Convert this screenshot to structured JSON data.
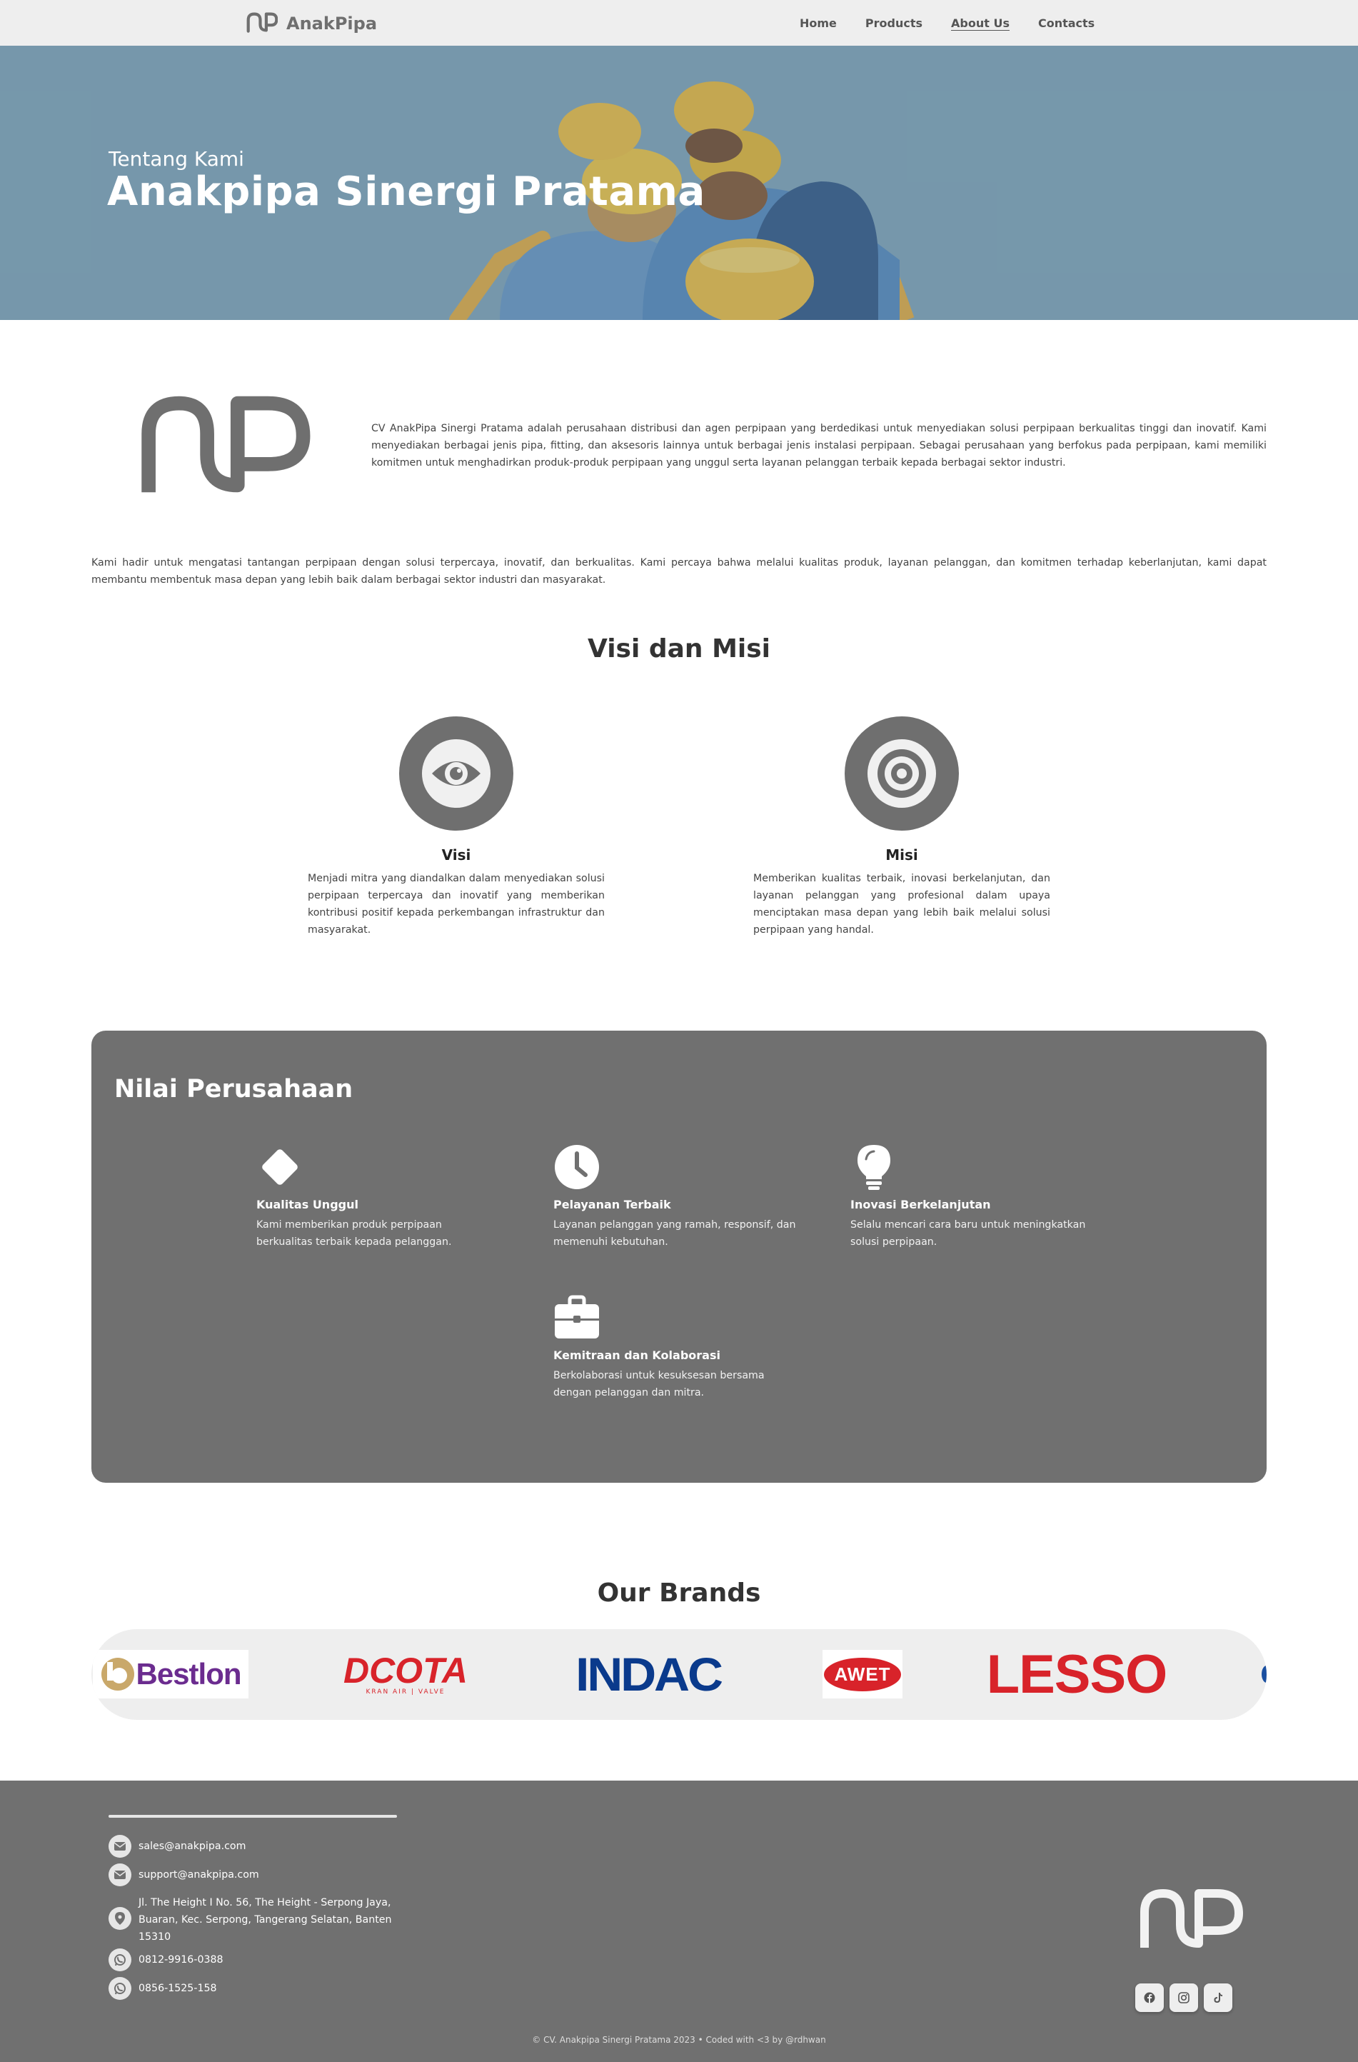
{
  "colors": {
    "nav_bg": "#eeeeee",
    "accent_gray": "#6f6f6f",
    "values_bg": "#707070",
    "footer_bg": "#707070",
    "text": "#333333",
    "white": "#ffffff"
  },
  "navbar": {
    "brand_name": "AnakPipa",
    "logo_icon": "np-logo-icon",
    "links": [
      {
        "label": "Home",
        "active": false
      },
      {
        "label": "Products",
        "active": false
      },
      {
        "label": "About Us",
        "active": true
      },
      {
        "label": "Contacts",
        "active": false
      }
    ]
  },
  "hero": {
    "subtitle": "Tentang Kami",
    "title": "Anakpipa Sinergi Pratama"
  },
  "intro": {
    "logo_icon": "np-logo-icon",
    "text": "CV AnakPipa Sinergi Pratama adalah perusahaan distribusi dan agen perpipaan yang berdedikasi untuk menyediakan solusi perpipaan berkualitas tinggi dan inovatif. Kami menyediakan berbagai jenis pipa, fitting, dan aksesoris lainnya untuk berbagai jenis instalasi perpipaan. Sebagai perusahaan yang berfokus pada perpipaan, kami memiliki komitmen untuk menghadirkan produk-produk perpipaan yang unggul serta layanan pelanggan terbaik kepada berbagai sektor industri.",
    "about": "Kami hadir untuk mengatasi tantangan perpipaan dengan solusi terpercaya, inovatif, dan berkualitas. Kami percaya bahwa melalui kualitas produk, layanan pelanggan, dan komitmen terhadap keberlanjutan, kami dapat membantu membentuk masa depan yang lebih baik dalam berbagai sektor industri dan masyarakat."
  },
  "visi_misi": {
    "title": "Visi dan Misi",
    "items": [
      {
        "icon": "eye-icon",
        "heading": "Visi",
        "text": "Menjadi mitra yang diandalkan dalam menyediakan solusi perpipaan terpercaya dan inovatif yang memberikan kontribusi positif kepada perkembangan infrastruktur dan masyarakat."
      },
      {
        "icon": "target-icon",
        "heading": "Misi",
        "text": "Memberikan kualitas terbaik, inovasi berkelanjutan, dan layanan pelanggan yang profesional dalam upaya menciptakan masa depan yang lebih baik melalui solusi perpipaan yang handal."
      }
    ]
  },
  "values": {
    "title": "Nilai Perusahaan",
    "items": [
      {
        "icon": "diamond-icon",
        "heading": "Kualitas Unggul",
        "text": "Kami memberikan produk perpipaan berkualitas terbaik kepada pelanggan."
      },
      {
        "icon": "clock-icon",
        "heading": "Pelayanan Terbaik",
        "text": "Layanan pelanggan yang ramah, responsif, dan memenuhi kebutuhan."
      },
      {
        "icon": "lightbulb-icon",
        "heading": "Inovasi Berkelanjutan",
        "text": "Selalu mencari cara baru untuk meningkatkan solusi perpipaan."
      },
      {
        "icon": "briefcase-icon",
        "heading": "Kemitraan dan Kolaborasi",
        "text": "Berkolaborasi untuk kesuksesan bersama dengan pelanggan dan mitra."
      }
    ]
  },
  "brands": {
    "title": "Our Brands",
    "items": [
      {
        "name": "Bestlon",
        "color": "#6b2c8f"
      },
      {
        "name": "DCOTA",
        "tagline": "KRAN AIR | VALVE",
        "color": "#d8232a"
      },
      {
        "name": "INDAC",
        "color": "#0a3a8c"
      },
      {
        "name": "AWET",
        "color": "#d8232a"
      },
      {
        "name": "LESSO",
        "color": "#d8232a"
      }
    ]
  },
  "footer": {
    "contacts": [
      {
        "icon": "envelope-icon",
        "text": "sales@anakpipa.com"
      },
      {
        "icon": "envelope-icon",
        "text": "support@anakpipa.com"
      },
      {
        "icon": "location-pin-icon",
        "text": "Jl. The Height I No. 56, The Height - Serpong Jaya, Buaran, Kec. Serpong, Tangerang Selatan, Banten 15310"
      },
      {
        "icon": "whatsapp-icon",
        "text": "0812-9916-0388"
      },
      {
        "icon": "whatsapp-icon",
        "text": "0856-1525-158"
      }
    ],
    "logo_icon": "np-logo-icon",
    "social": [
      {
        "icon": "facebook-icon"
      },
      {
        "icon": "instagram-icon"
      },
      {
        "icon": "tiktok-icon"
      }
    ],
    "copyright": "© CV. Anakpipa Sinergi Pratama 2023 • Coded with <3 by @rdhwan"
  }
}
